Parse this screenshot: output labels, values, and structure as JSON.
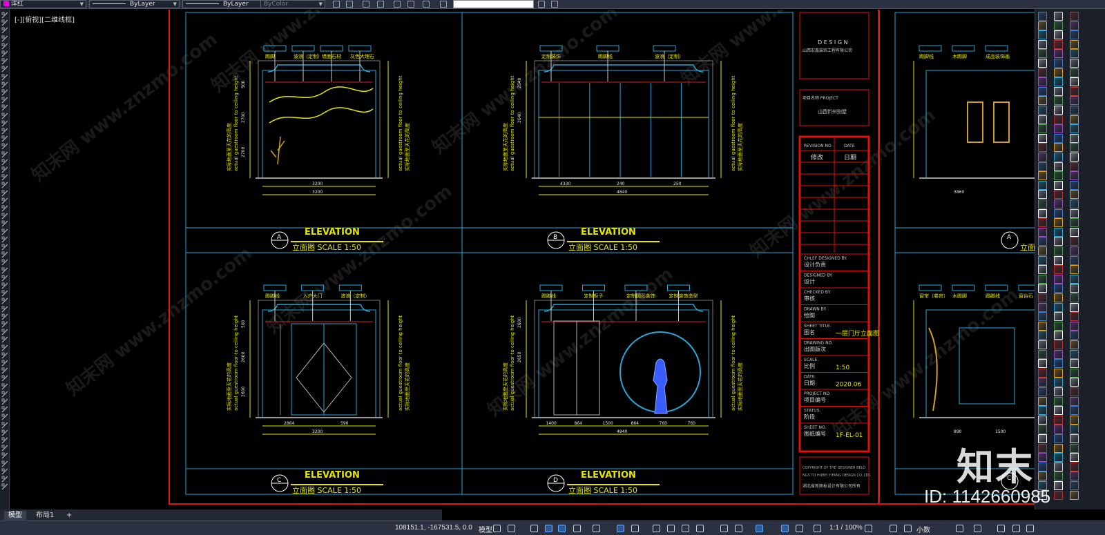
{
  "toolbar": {
    "color_value": "洋红",
    "linetype_value": "ByLayer",
    "lineweight_value": "ByLayer",
    "plotstyle_value": "ByColor"
  },
  "viewport": {
    "label": "[-][俯视][二维线框]"
  },
  "drawing": {
    "elevation_word": "ELEVATION",
    "panels": [
      {
        "letter": "A",
        "caption": "立面图  SCALE 1:50",
        "callouts": [
          "踢脚",
          "波浪（定制）",
          "墙面石材",
          "灰色大理石"
        ],
        "dims": [
          "3200",
          "3200"
        ],
        "height_dims": [
          "500",
          "2700",
          "2700"
        ]
      },
      {
        "letter": "B",
        "caption": "立面图  SCALE 1:50",
        "callouts": [
          "定制装饰",
          "踢脚线",
          "波浪（定制）"
        ],
        "dims": [
          "4330",
          "240",
          "250",
          "4840"
        ],
        "height_dims": [
          "2540",
          "2640"
        ]
      },
      {
        "letter": "C",
        "caption": "立面图  SCALE 1:50",
        "callouts": [
          "踢脚线",
          "入户大门",
          "波浪（定制）"
        ],
        "dims": [
          "2864",
          "590",
          "3200"
        ],
        "height_dims": [
          "500",
          "2600",
          "2600"
        ]
      },
      {
        "letter": "D",
        "caption": "立面图  SCALE 1:50",
        "callouts": [
          "踢脚线",
          "定制柜子",
          "定制圆形装饰",
          "定制装饰造型"
        ],
        "dims": [
          "1400",
          "864",
          "1500",
          "864",
          "760",
          "760",
          "4840"
        ],
        "height_dims": [
          "2600",
          "2650"
        ]
      }
    ],
    "side_label": "实际地面至天花的高度",
    "side_label_en": "actual guestroom floor to ceiling height",
    "partial_panels": [
      {
        "letter": "A",
        "caption": "立面",
        "dims": [
          "3860"
        ],
        "callouts": [
          "踢脚线",
          "木踢脚",
          "成品装饰画"
        ]
      },
      {
        "letter": "C",
        "caption": "",
        "dims": [
          "890",
          "1500"
        ],
        "callouts": [
          "窗帘（卷帘）",
          "木踢脚",
          "踢脚线",
          "窗台石"
        ]
      }
    ]
  },
  "title_block": {
    "design_word": "D E S I G N",
    "company": "山西宏鑫装饰工程有限公司",
    "project_label": "项目名称 PROJECT",
    "project_name": "山西忻州别墅",
    "revision_no_label": "REVISION NO",
    "date_label": "DATE",
    "revision_cn": "修改",
    "date_cn": "日期",
    "rows": [
      {
        "en": "CHLEF DESIGNED BY.",
        "cn": "设计负责",
        "value": ""
      },
      {
        "en": "DESIGNED BY.",
        "cn": "设计",
        "value": ""
      },
      {
        "en": "CHECKED BY.",
        "cn": "审核",
        "value": ""
      },
      {
        "en": "DRAWN BY.",
        "cn": "绘图",
        "value": ""
      },
      {
        "en": "SHEET TITLE.",
        "cn": "图名",
        "value": "一层门厅立面图"
      },
      {
        "en": "DRAWING NO.",
        "cn": "出图版次",
        "value": ""
      },
      {
        "en": "SCALE.",
        "cn": "比例",
        "value": "1:50"
      },
      {
        "en": "DATE.",
        "cn": "日期",
        "value": "2020.06"
      },
      {
        "en": "PROJECT NO.",
        "cn": "项目编号",
        "value": ""
      },
      {
        "en": "STATUS.",
        "cn": "阶段",
        "value": ""
      },
      {
        "en": "SHEET NO.",
        "cn": "图纸编号",
        "value": "1F-EL-01"
      }
    ],
    "copyright_en": "COPYRIGHT OF THE DESIGNER BELONGS TO HUBEI YIFANG DESIGN CO.,LTD.",
    "copyright_cn": "湖北省新图标设计有限公司所有"
  },
  "watermark": {
    "repeat_text": "www.znzmo.com",
    "repeat_cn": "知末网",
    "logo": "知末",
    "id_text": "ID: 1142660985"
  },
  "tabs": [
    {
      "label": "模型",
      "active": true
    },
    {
      "label": "布局1",
      "active": false
    },
    {
      "label": "+",
      "active": false
    }
  ],
  "status": {
    "coords": "108151.1, -167531.5, 0.0",
    "space": "模型",
    "scale": "1:1 / 100%",
    "units": "小数"
  },
  "colors": {
    "frame_cyan": "#2aa6d6",
    "sheet_red": "#e01010",
    "drawing_yellow": "#e6e600",
    "figure_blue": "#4466ff",
    "ui_dark": "#2b3140"
  }
}
